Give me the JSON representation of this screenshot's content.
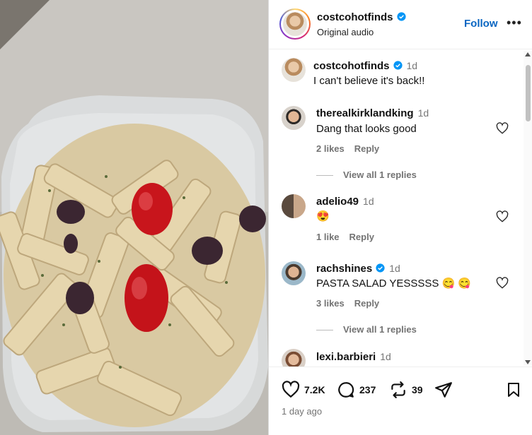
{
  "post": {
    "username": "costcohotfinds",
    "audio": "Original audio",
    "follow_label": "Follow",
    "more_label": "•••",
    "posted": "1 day ago"
  },
  "comments": [
    {
      "username": "costcohotfinds",
      "verified": true,
      "time": "1d",
      "text": "I can't believe it's back!!"
    },
    {
      "username": "therealkirklandking",
      "verified": false,
      "time": "1d",
      "text": "Dang that looks good",
      "likes": "2 likes",
      "reply": "Reply",
      "view_replies": "View all 1 replies"
    },
    {
      "username": "adelio49",
      "verified": false,
      "time": "1d",
      "text": "😍",
      "likes": "1 like",
      "reply": "Reply"
    },
    {
      "username": "rachshines",
      "verified": true,
      "time": "1d",
      "text": "PASTA SALAD YESSSSS 😋 😋",
      "likes": "3 likes",
      "reply": "Reply",
      "view_replies": "View all 1 replies"
    },
    {
      "username": "lexi.barbieri",
      "verified": false,
      "time": "1d"
    }
  ],
  "actions": {
    "likes": "7.2K",
    "comments": "237",
    "reposts": "39"
  },
  "colors": {
    "accent": "#0a66c2",
    "verified": "#0095f6",
    "muted": "#737373"
  }
}
